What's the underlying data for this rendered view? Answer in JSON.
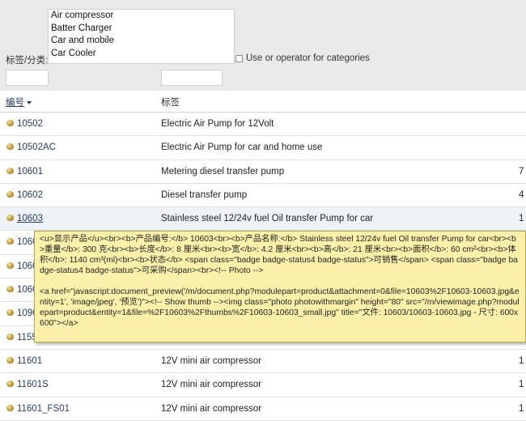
{
  "filter": {
    "categories": [
      "Air compressor",
      "Batter Charger",
      "Car and mobile",
      "Car Cooler"
    ],
    "tags_label": "标签/分类:",
    "or_label": "Use or operator for categories",
    "or_checked": false,
    "search_ref_value": "",
    "search_tag_value": ""
  },
  "header": {
    "ref": "编号",
    "tag": "标签"
  },
  "rows": [
    {
      "ref": "10502",
      "label": "Electric Air Pump for 12Volt",
      "extra": ""
    },
    {
      "ref": "10502AC",
      "label": "Electric Air Pump for car and home use",
      "extra": ""
    },
    {
      "ref": "10601",
      "label": "Metering diesel transfer pump",
      "extra": "7"
    },
    {
      "ref": "10602",
      "label": "Diesel transfer pump",
      "extra": "4"
    },
    {
      "ref": "10603",
      "label": "Stainless steel 12/24v fuel Oil transfer Pump for car",
      "extra": "1"
    },
    {
      "ref": "1060",
      "label": "",
      "extra": ""
    },
    {
      "ref": "1060",
      "label": "",
      "extra": ""
    },
    {
      "ref": "1060",
      "label": "",
      "extra": ""
    },
    {
      "ref": "1090",
      "label": "",
      "extra": ""
    },
    {
      "ref": "1155",
      "label": "",
      "extra": ""
    },
    {
      "ref": "11601",
      "label": "12V mini air compressor",
      "extra": "1"
    },
    {
      "ref": "11601S",
      "label": "12V mini air compressor",
      "extra": "1"
    },
    {
      "ref": "11601_FS01",
      "label": "12V mini air compressor",
      "extra": "1"
    }
  ],
  "tooltip": {
    "line1": "<u>显示产品</u><br><b>产品编号:</b> 10603<br><b>产品名称:</b> Stainless steel 12/24v fuel Oil transfer Pump for car<br><b>重量</b>: 300 克<br><b>长度</b>: 8 厘米<br><b>宽</b>: 4.2 厘米<br><b>高</b>: 21 厘米<br><b>面积</b>: 60 cm²<br><b>体积</b>: 1140 cm³(ml)<br><b>状态</b> <span class=\"badge  badge-status4 badge-status\">可销售</span> <span class=\"badge  badge-status4 badge-status\">可采购</span><br><!-- Photo -->",
    "line2": "<a href=\"javascript:document_preview('/m/document.php?modulepart=product&attachment=0&file=10603%2F10603-10603.jpg&entity=1', 'image/jpeg', '预览')\"><!-- Show thumb --><img class=\"photo photowithmargin\"  height=\"80\" src=\"/m/viewimage.php?modulepart=product&entity=1&file=%2F10603%2Fthumbs%2F10603-10603_small.jpg\" title=\"文件: 10603/10603-10603.jpg - 尺寸: 600x600\"></a>"
  }
}
